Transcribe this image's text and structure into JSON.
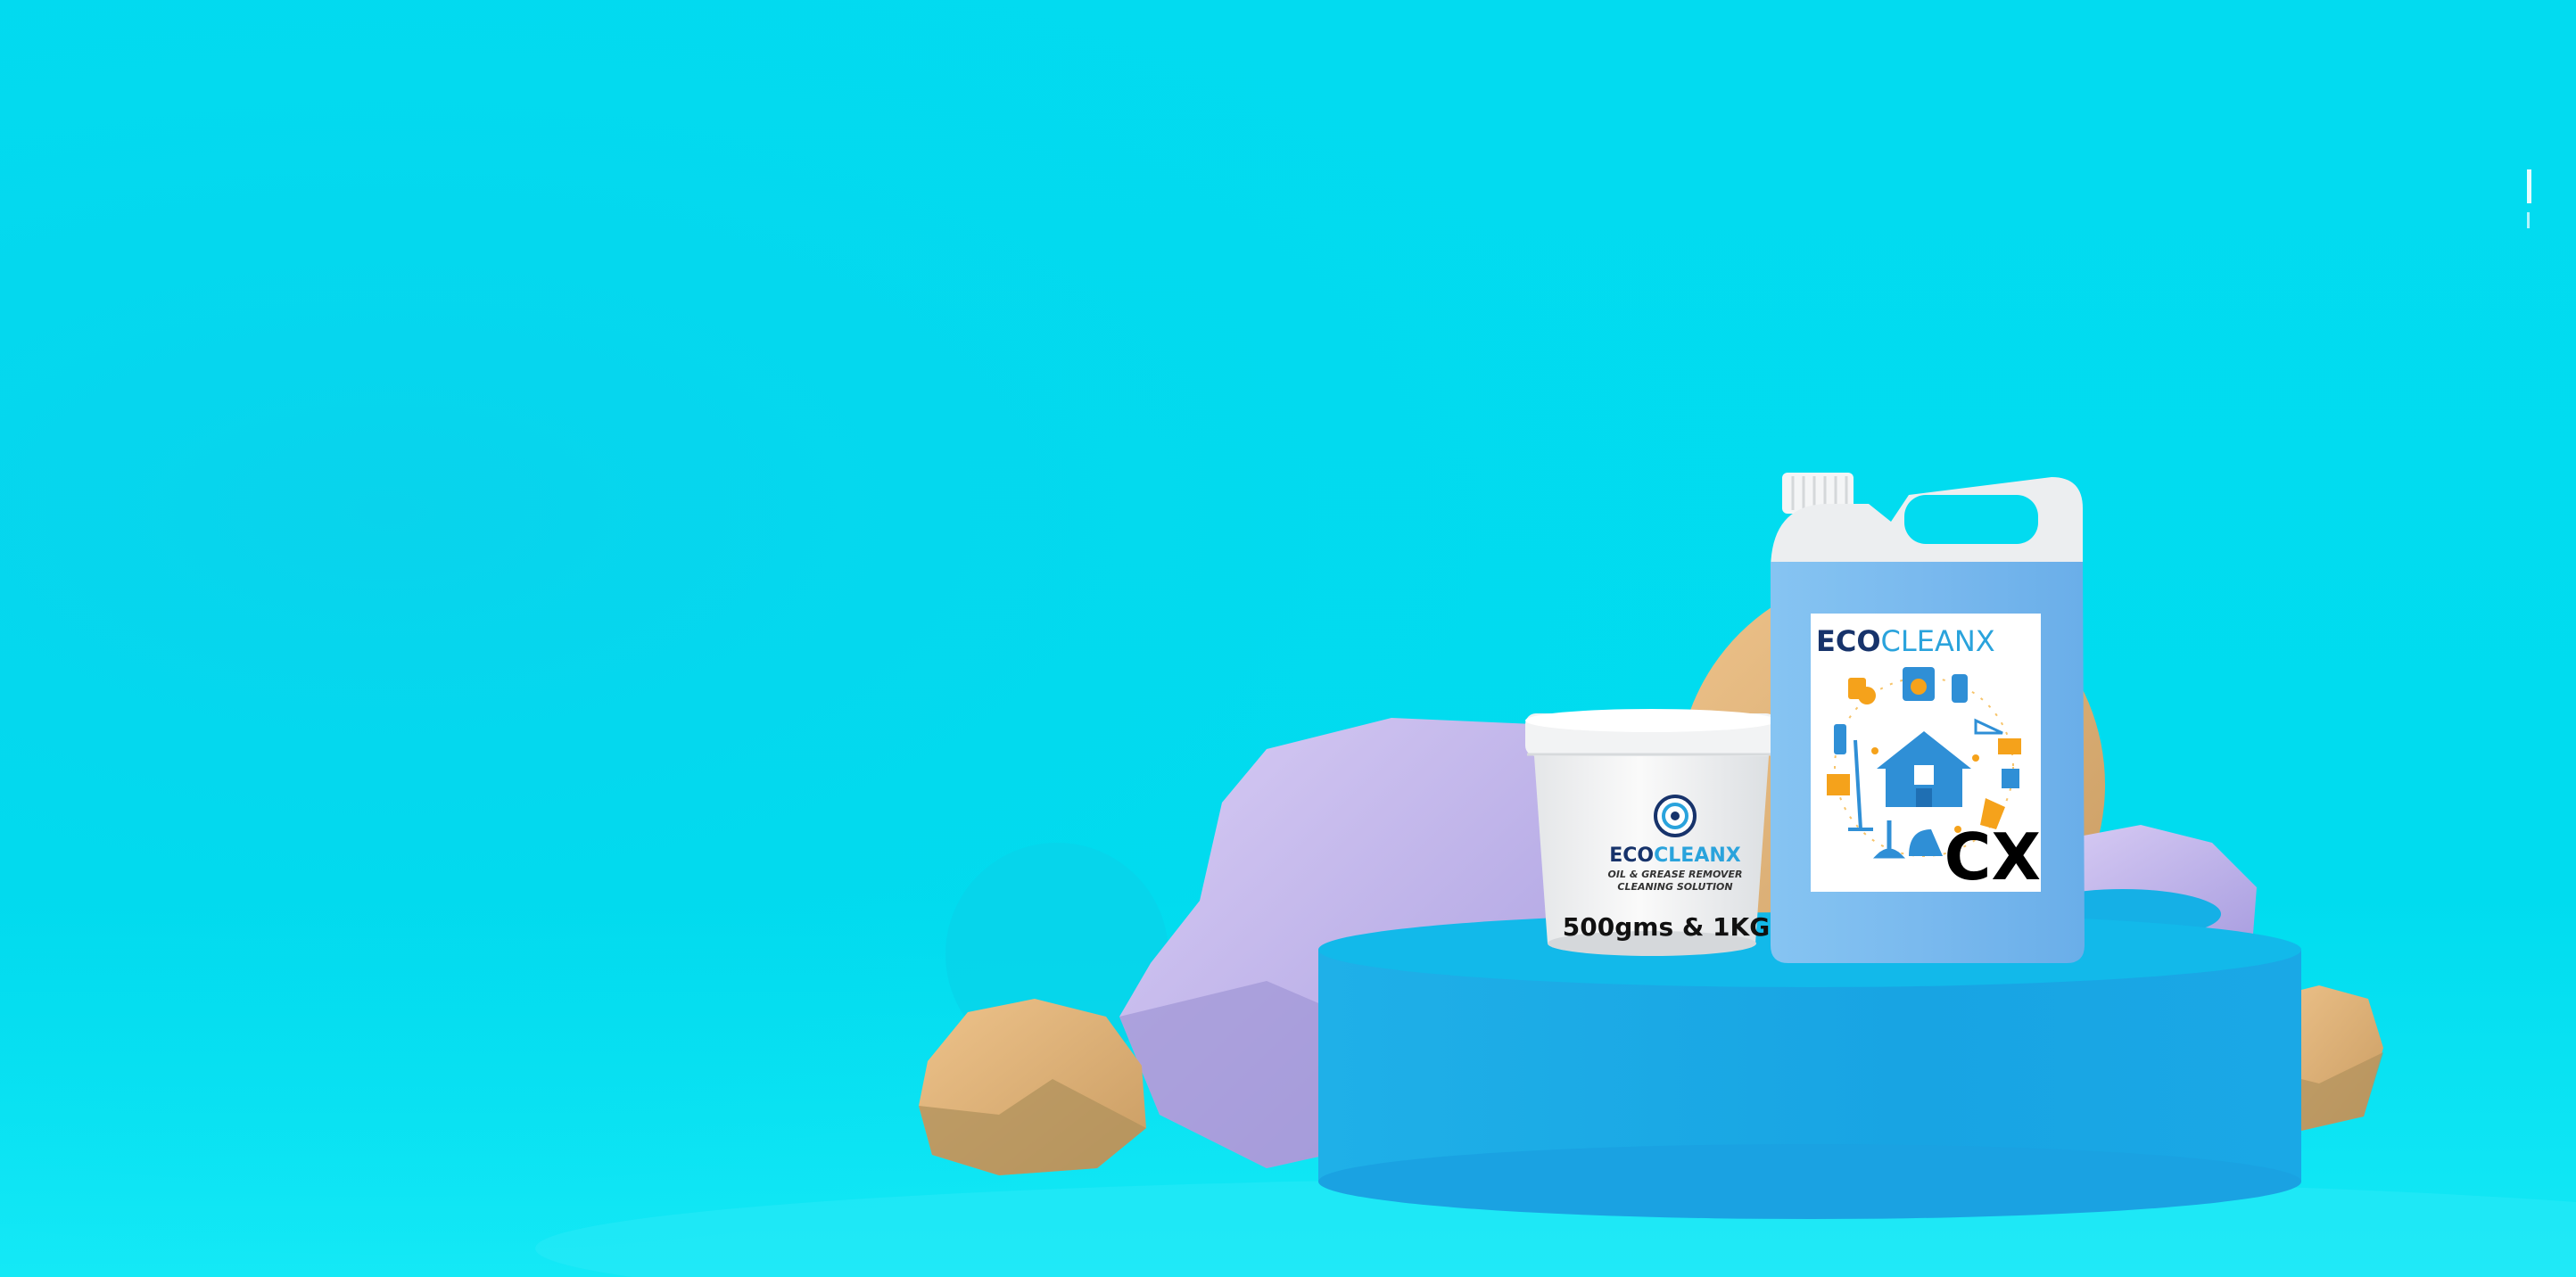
{
  "colors": {
    "background": "#00d8ee",
    "background_light": "#12e6f6",
    "podium_top": "#12b8ea",
    "podium_side": "#1aa6e4",
    "rock": "#e7b57a",
    "rock_shadow": "#b0915c",
    "crystal": "#c6b7ee",
    "jerry_can": "#7cbcf0",
    "brand_dark": "#17336b",
    "brand_light": "#2aa3dc",
    "icon_accent": "#f5a21b"
  },
  "tub": {
    "brand_part1": "ECO",
    "brand_part2": "CLEANX",
    "subtitle_line1": "OIL & GREASE REMOVER",
    "subtitle_line2": "CLEANING SOLUTION",
    "sizes": "500gms & 1KG"
  },
  "jerry_can": {
    "brand_part1": "ECO",
    "brand_part2": "CLEANX",
    "monogram": "CX"
  }
}
